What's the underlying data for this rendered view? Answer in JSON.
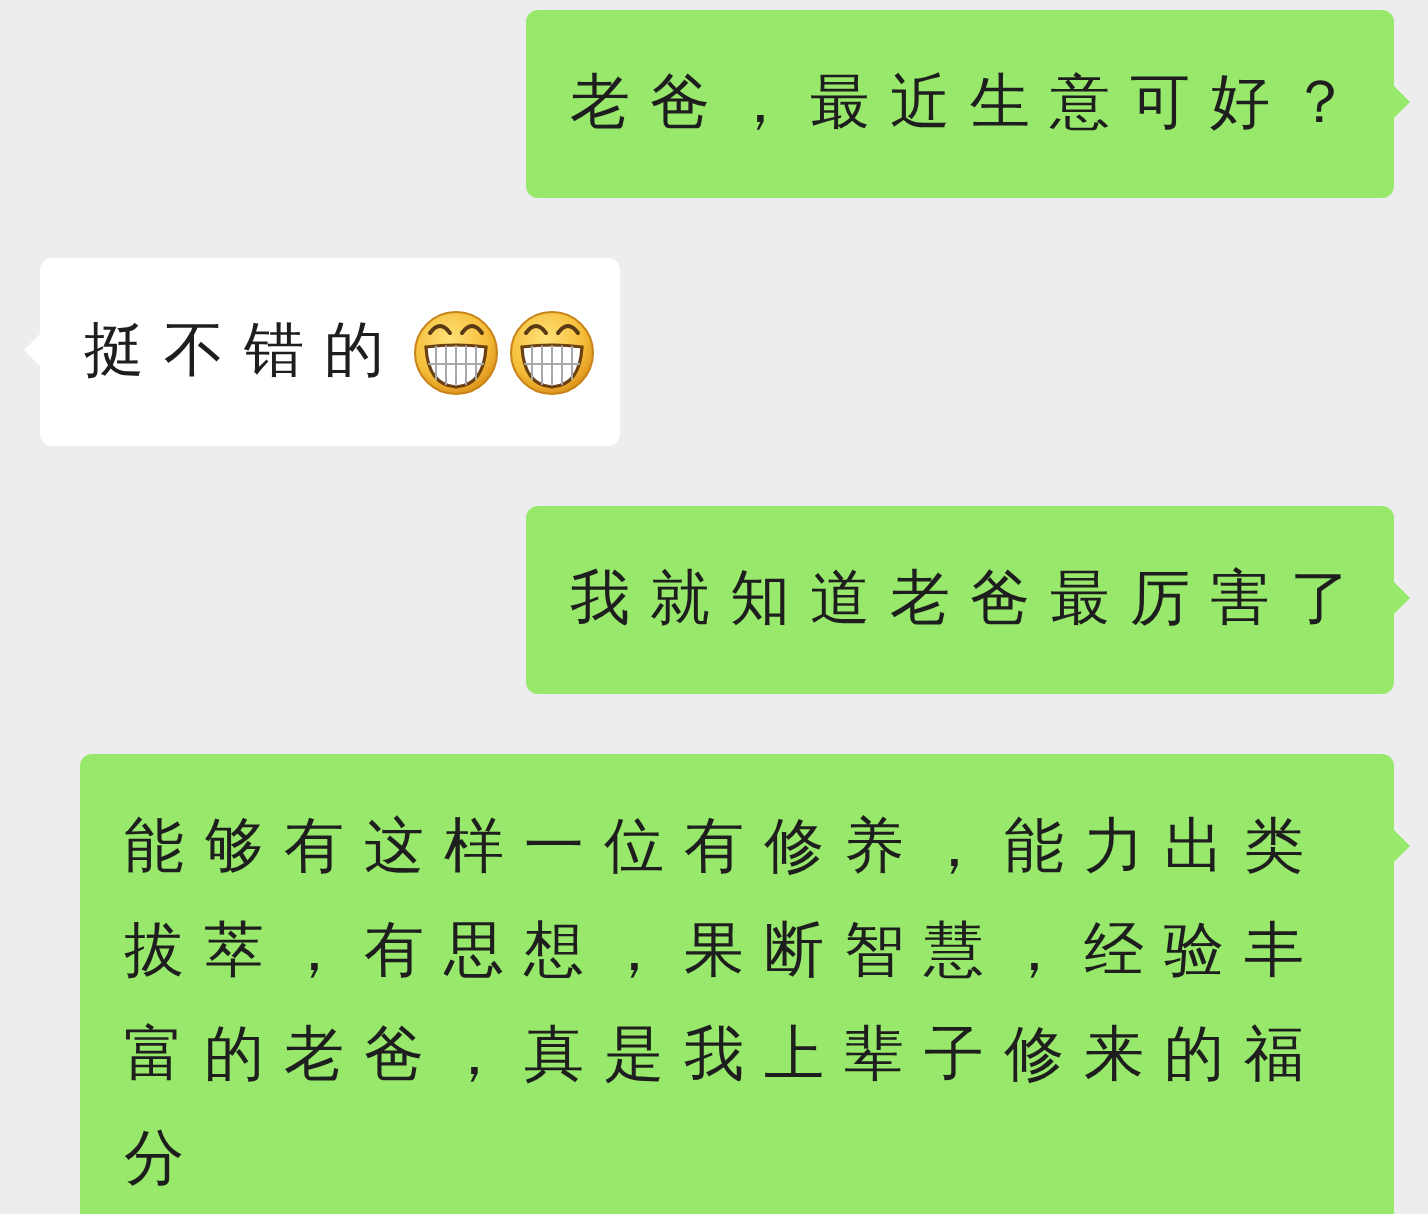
{
  "messages": [
    {
      "kind": "sent",
      "text": "老爸，最近生意可好？"
    },
    {
      "kind": "received",
      "text": "挺不错的",
      "emojis": [
        {
          "kind": "grin"
        },
        {
          "kind": "grin"
        }
      ]
    },
    {
      "kind": "sent",
      "text": "我就知道老爸最厉害了"
    },
    {
      "kind": "sent",
      "text": "能够有这样一位有修养，能力出类拔萃，有思想，果断智慧，经验丰富的老爸，真是我上辈子修来的福分"
    }
  ]
}
